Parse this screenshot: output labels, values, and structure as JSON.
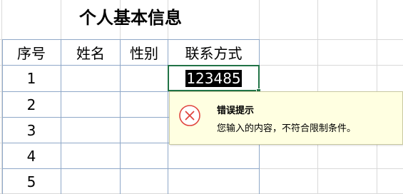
{
  "sheet": {
    "title": "个人基本信息",
    "headers": [
      "序号",
      "姓名",
      "性别",
      "联系方式"
    ],
    "rows": [
      {
        "index": "1",
        "name": "",
        "gender": "",
        "contact": "123485"
      },
      {
        "index": "2",
        "name": "",
        "gender": "",
        "contact": ""
      },
      {
        "index": "3",
        "name": "",
        "gender": "",
        "contact": ""
      },
      {
        "index": "4",
        "name": "",
        "gender": "",
        "contact": ""
      },
      {
        "index": "5",
        "name": "",
        "gender": "",
        "contact": ""
      }
    ]
  },
  "validation_tooltip": {
    "title": "错误提示",
    "message": "您输入的内容，不符合限制条件。",
    "icon": "error-circle-x-icon",
    "icon_color": "#e0443e"
  },
  "colors": {
    "active_cell_border": "#217346",
    "gridline": "#d9d9d9",
    "table_border": "#8fa8c8",
    "tooltip_bg": "#ffffe1"
  }
}
